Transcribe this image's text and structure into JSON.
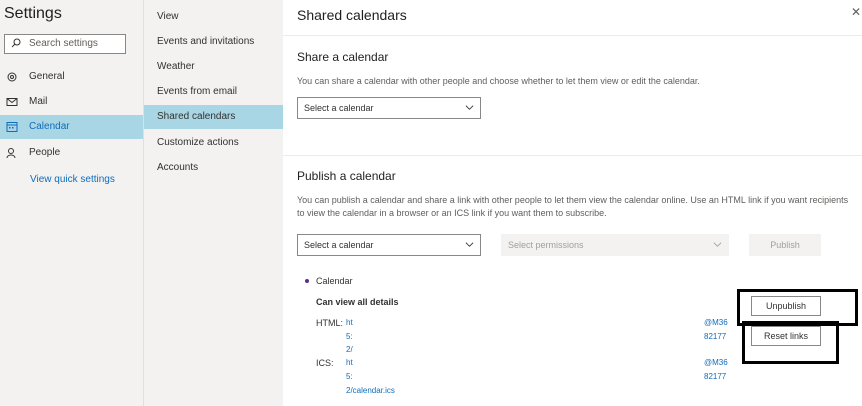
{
  "left_nav": {
    "title": "Settings",
    "search_placeholder": "Search settings",
    "items": [
      {
        "label": "General",
        "icon": "gear-icon"
      },
      {
        "label": "Mail",
        "icon": "mail-icon"
      },
      {
        "label": "Calendar",
        "icon": "calendar-icon",
        "selected": true
      },
      {
        "label": "People",
        "icon": "people-icon"
      }
    ],
    "quick_settings": "View quick settings"
  },
  "sub_nav": {
    "items": [
      {
        "label": "View"
      },
      {
        "label": "Events and invitations"
      },
      {
        "label": "Weather"
      },
      {
        "label": "Events from email"
      },
      {
        "label": "Shared calendars",
        "selected": true
      },
      {
        "label": "Customize actions"
      },
      {
        "label": "Accounts"
      }
    ]
  },
  "main": {
    "title": "Shared calendars",
    "share": {
      "heading": "Share a calendar",
      "description": "You can share a calendar with other people and choose whether to let them view or edit the calendar.",
      "select_placeholder": "Select a calendar"
    },
    "publish": {
      "heading": "Publish a calendar",
      "description": "You can publish a calendar and share a link with other people to let them view the calendar online. Use an HTML link if you want recipients to view the calendar in a browser or an ICS link if you want them to subscribe.",
      "select_calendar": "Select a calendar",
      "select_permissions": "Select permissions",
      "publish_button": "Publish"
    },
    "published": {
      "calendar_name": "Calendar",
      "permission": "Can view all details",
      "html_label": "HTML:",
      "ics_label": "ICS:",
      "html_link": {
        "line1": "ht",
        "line2": "5:",
        "line3": "2/",
        "right1": "@M36",
        "right2": "82177"
      },
      "ics_link": {
        "line1": "ht",
        "line2": "5:",
        "line3": "2/calendar.ics",
        "right1": "@M36",
        "right2": "82177"
      },
      "unpublish_button": "Unpublish",
      "reset_button": "Reset links"
    }
  },
  "colors": {
    "accent": "#0f6cbd",
    "selected_bg": "#a9d6e5",
    "nav_bg": "#f3f2f1",
    "bullet": "#5c2d91"
  }
}
